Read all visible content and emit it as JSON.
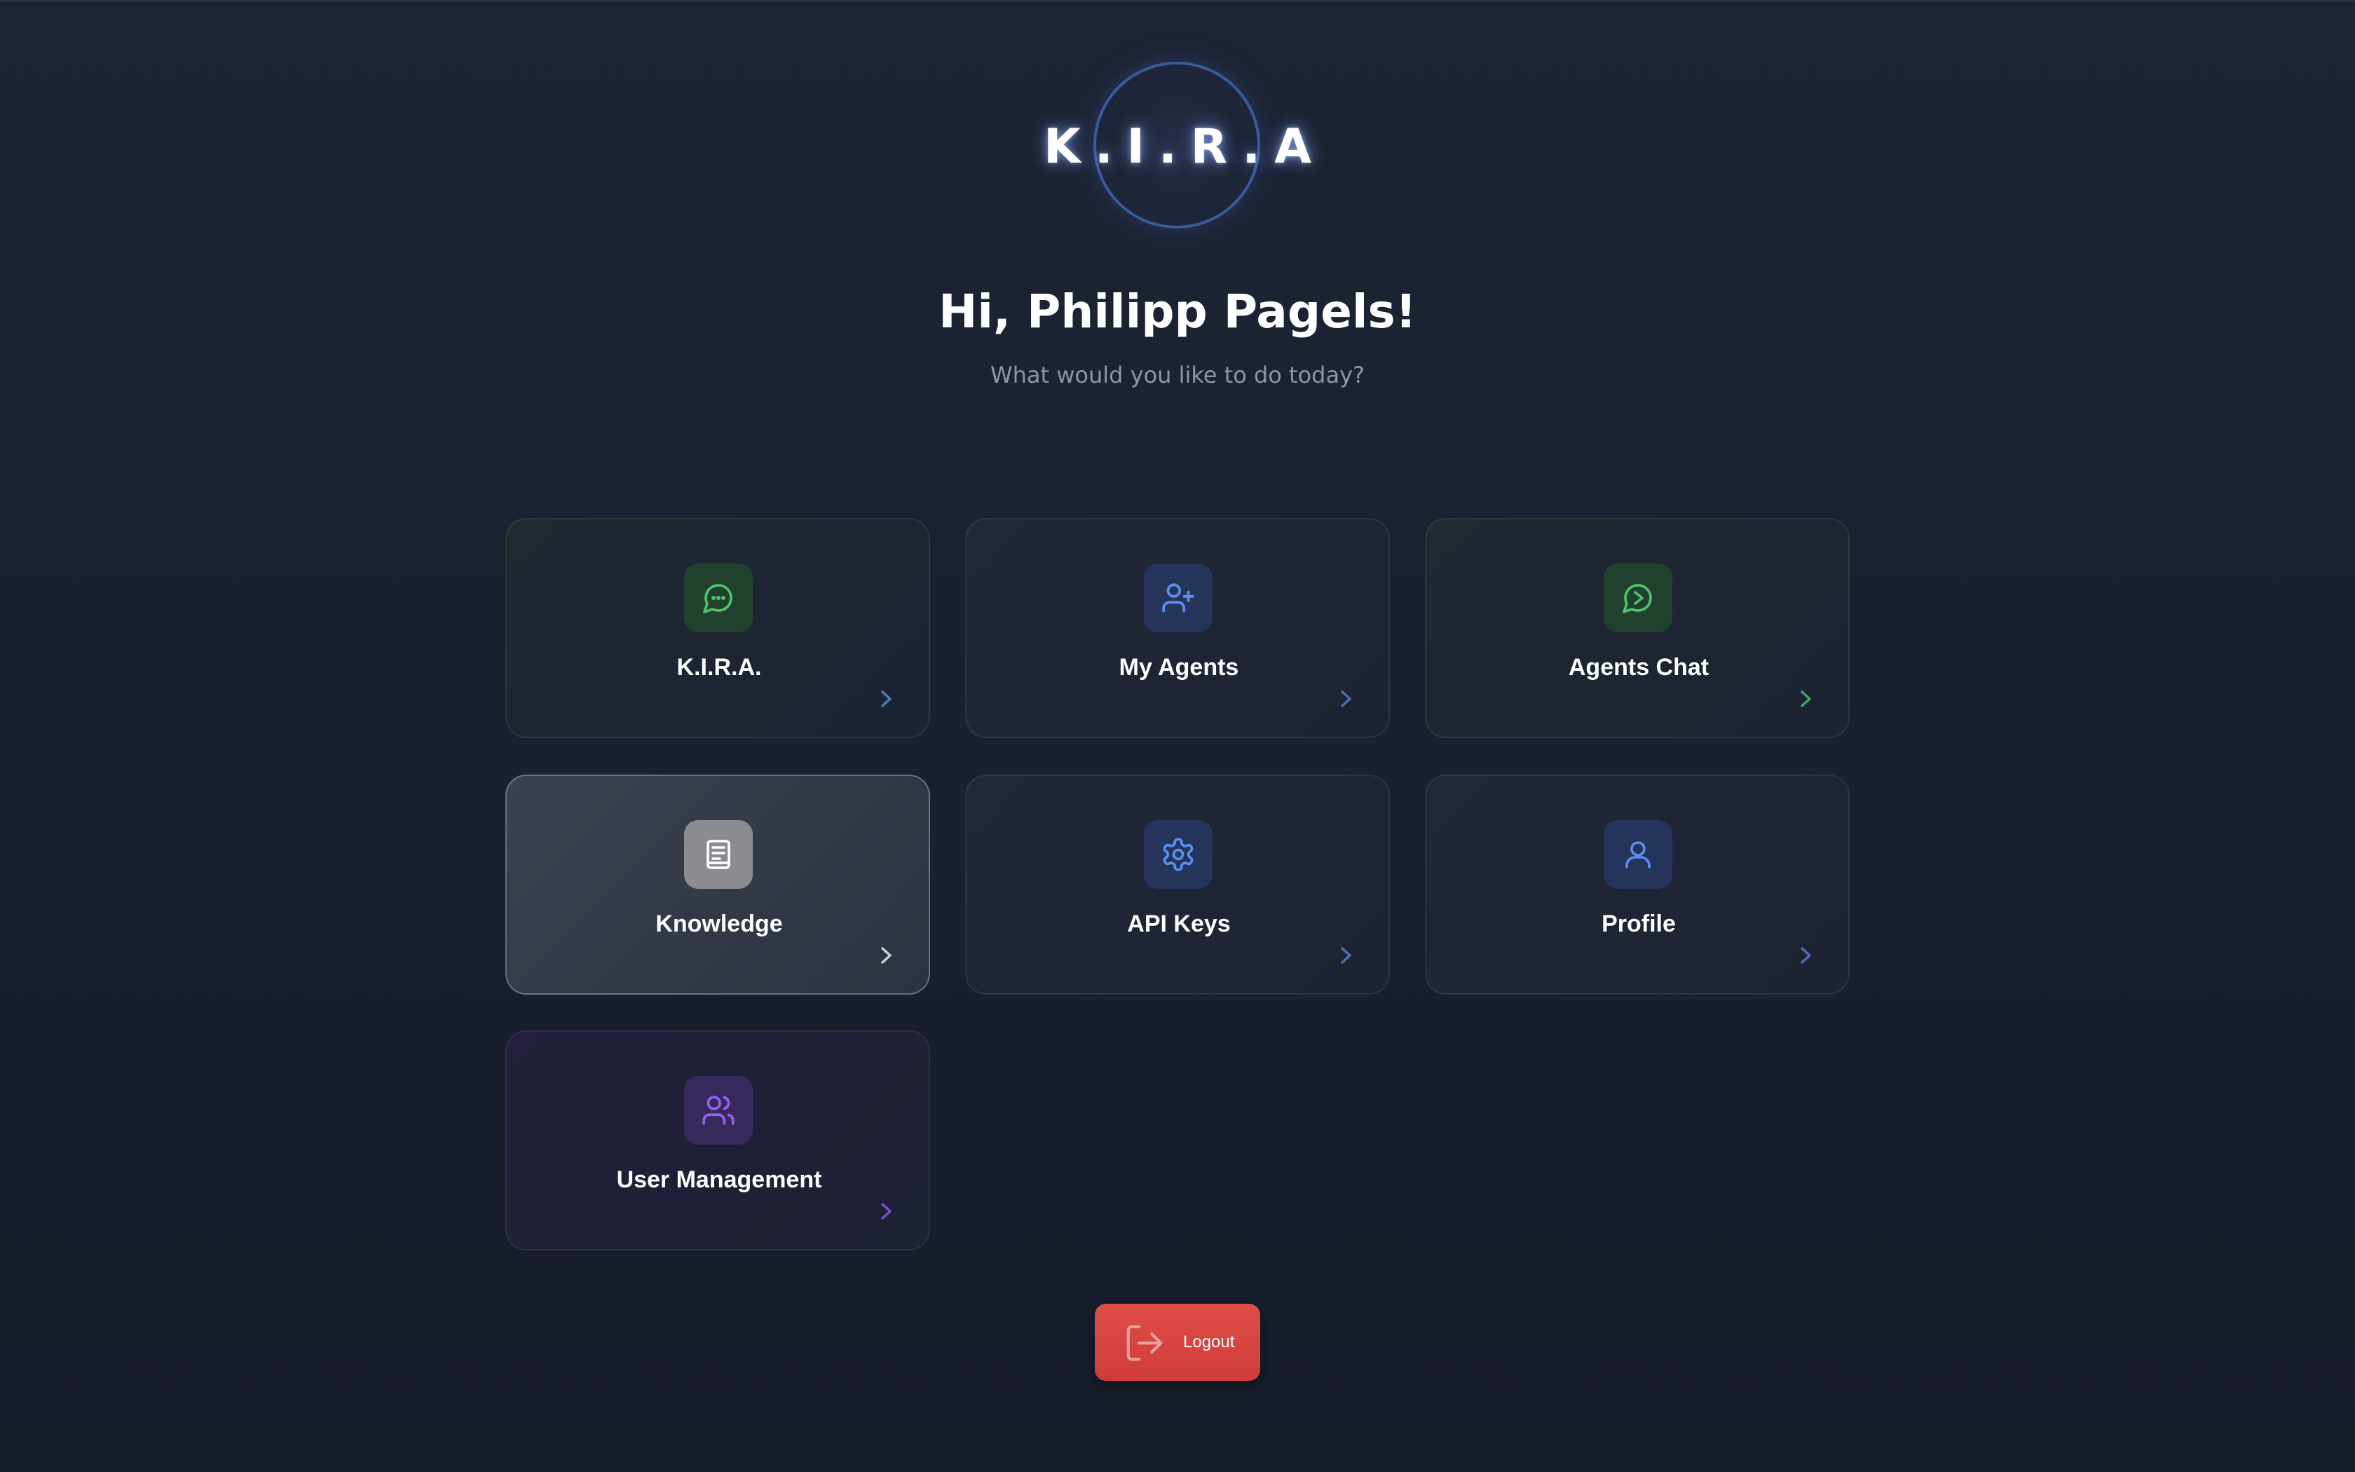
{
  "app": {
    "logo_text": "K.I.R.A",
    "greeting": "Hi, Philipp Pagels!",
    "subtitle": "What would you like to do today?"
  },
  "cards": [
    {
      "label": "K.I.R.A.",
      "icon": "message-dots-icon",
      "accent": "#4fc46e",
      "active": false
    },
    {
      "label": "My Agents",
      "icon": "user-plus-icon",
      "accent": "#5b8ff0",
      "active": false
    },
    {
      "label": "Agents Chat",
      "icon": "chat-bubble-icon",
      "accent": "#4fc46e",
      "active": false
    },
    {
      "label": "Knowledge",
      "icon": "document-icon",
      "accent": "#ffffff",
      "active": true
    },
    {
      "label": "API Keys",
      "icon": "gear-icon",
      "accent": "#5b8ff0",
      "active": false
    },
    {
      "label": "Profile",
      "icon": "user-icon",
      "accent": "#5b8ff0",
      "active": false
    },
    {
      "label": "User Management",
      "icon": "users-icon",
      "accent": "#9a5ef0",
      "active": false
    }
  ],
  "logout": {
    "label": "Logout",
    "icon": "logout-icon",
    "color": "#dc4a46"
  }
}
